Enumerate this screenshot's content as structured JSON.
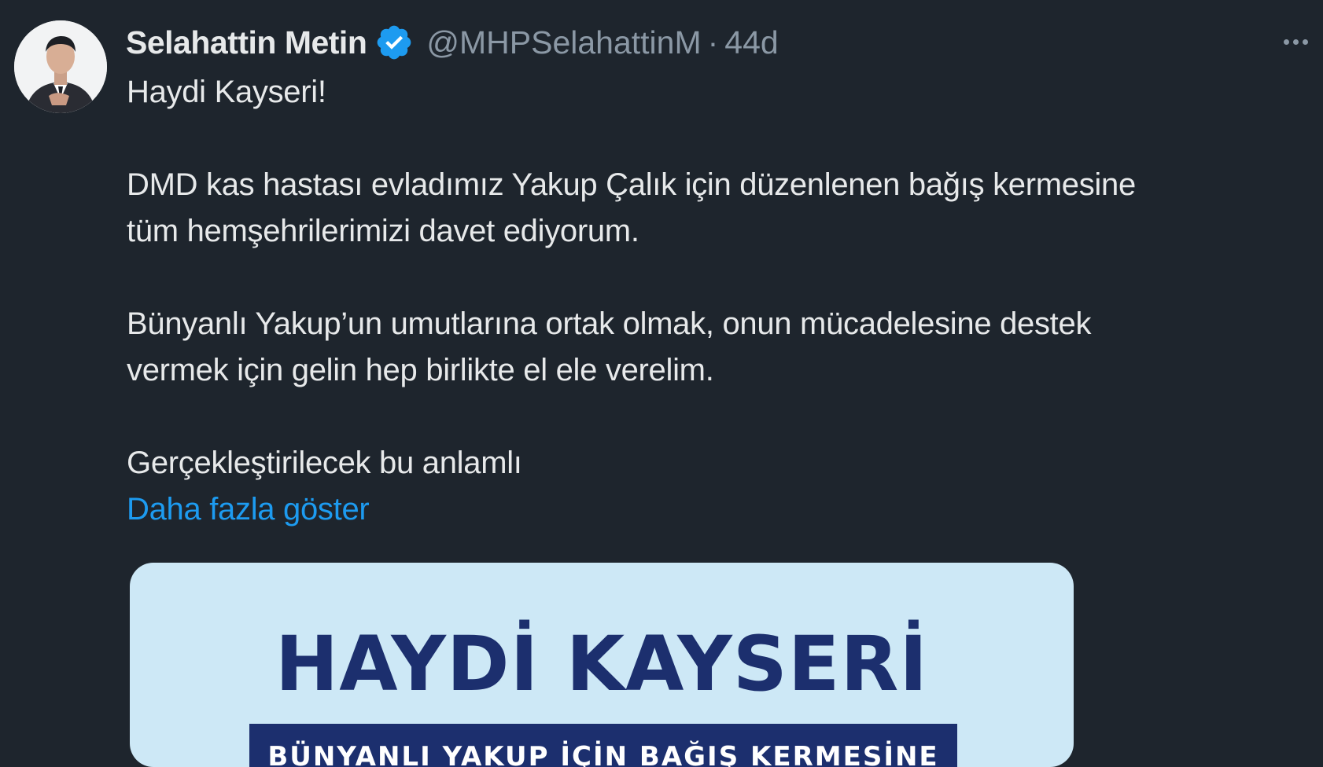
{
  "author": {
    "display_name": "Selahattin Metin",
    "handle": "@MHPSelahattinM",
    "separator": "·",
    "time_ago": "44d",
    "verified": true
  },
  "tweet": {
    "lines": [
      "Haydi Kayseri!",
      "",
      "DMD kas hastası evladımız Yakup Çalık için düzenlenen bağış kermesine",
      "tüm hemşehrilerimizi davet ediyorum.",
      "",
      "Bünyanlı Yakup’un umutlarına ortak olmak, onun mücadelesine destek",
      "vermek için gelin hep birlikte el ele verelim.",
      "",
      "Gerçekleştirilecek bu anlamlı"
    ],
    "show_more_label": "Daha fazla göster"
  },
  "media": {
    "title": "HAYDİ KAYSERİ",
    "banner_text": "BÜNYANLI YAKUP İÇİN BAĞIŞ KERMESİNE"
  },
  "icons": {
    "verified": "verified-badge-icon",
    "more": "more-options-icon"
  },
  "colors": {
    "background": "#1e252d",
    "text": "#e7e9ea",
    "muted": "#8b98a5",
    "link": "#1d9bf0",
    "verified": "#1d9bf0",
    "media_bg": "#cde8f6",
    "media_navy": "#1c2f6e"
  }
}
